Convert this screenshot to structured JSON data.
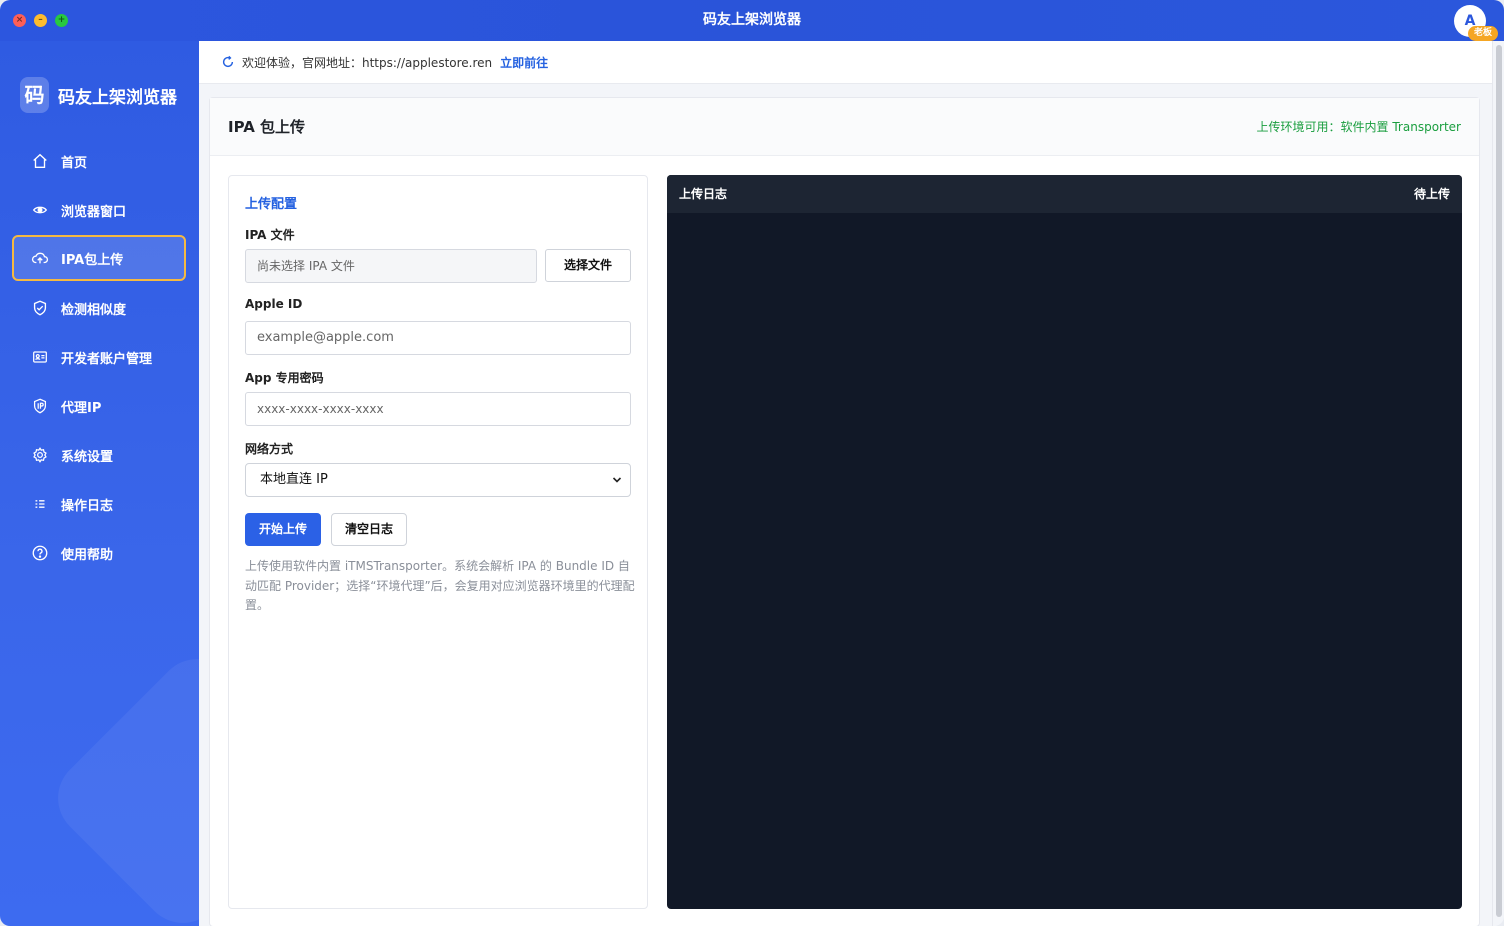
{
  "window": {
    "title": "码友上架浏览器"
  },
  "user": {
    "avatar_letter": "A",
    "badge": "老板"
  },
  "sidebar": {
    "brand_logo": "码",
    "brand_name": "码友上架浏览器",
    "items": [
      {
        "label": "首页",
        "icon": "home-icon"
      },
      {
        "label": "浏览器窗口",
        "icon": "browser-window-icon"
      },
      {
        "label": "IPA包上传",
        "icon": "cloud-upload-icon",
        "active": true
      },
      {
        "label": "检测相似度",
        "icon": "shield-check-icon"
      },
      {
        "label": "开发者账户管理",
        "icon": "id-card-icon"
      },
      {
        "label": "代理IP",
        "icon": "proxy-ip-icon"
      },
      {
        "label": "系统设置",
        "icon": "gear-icon"
      },
      {
        "label": "操作日志",
        "icon": "list-icon"
      },
      {
        "label": "使用帮助",
        "icon": "help-icon"
      }
    ]
  },
  "notice": {
    "text": "欢迎体验，官网地址：https://applestore.ren",
    "link": "立即前往"
  },
  "page": {
    "title": "IPA 包上传",
    "status": "上传环境可用：软件内置 Transporter"
  },
  "config": {
    "section_title": "上传配置",
    "ipa_label": "IPA 文件",
    "ipa_value": "尚未选择 IPA 文件",
    "choose_file": "选择文件",
    "apple_id_label": "Apple ID",
    "apple_id_placeholder": "example@apple.com",
    "password_label": "App 专用密码",
    "password_placeholder": "xxxx-xxxx-xxxx-xxxx",
    "network_label": "网络方式",
    "network_value": "本地直连 IP",
    "start_upload": "开始上传",
    "clear_log": "清空日志",
    "hint": "上传使用软件内置 iTMSTransporter。系统会解析 IPA 的 Bundle ID 自动匹配 Provider；选择“环境代理”后，会复用对应浏览器环境里的代理配置。"
  },
  "log": {
    "title": "上传日志",
    "status": "待上传"
  },
  "colors": {
    "sidebar": "#2f5be2",
    "accent": "#2b61e6",
    "active_border": "#f5b942",
    "status_green": "#1a9e3f",
    "log_bg": "#111827"
  }
}
